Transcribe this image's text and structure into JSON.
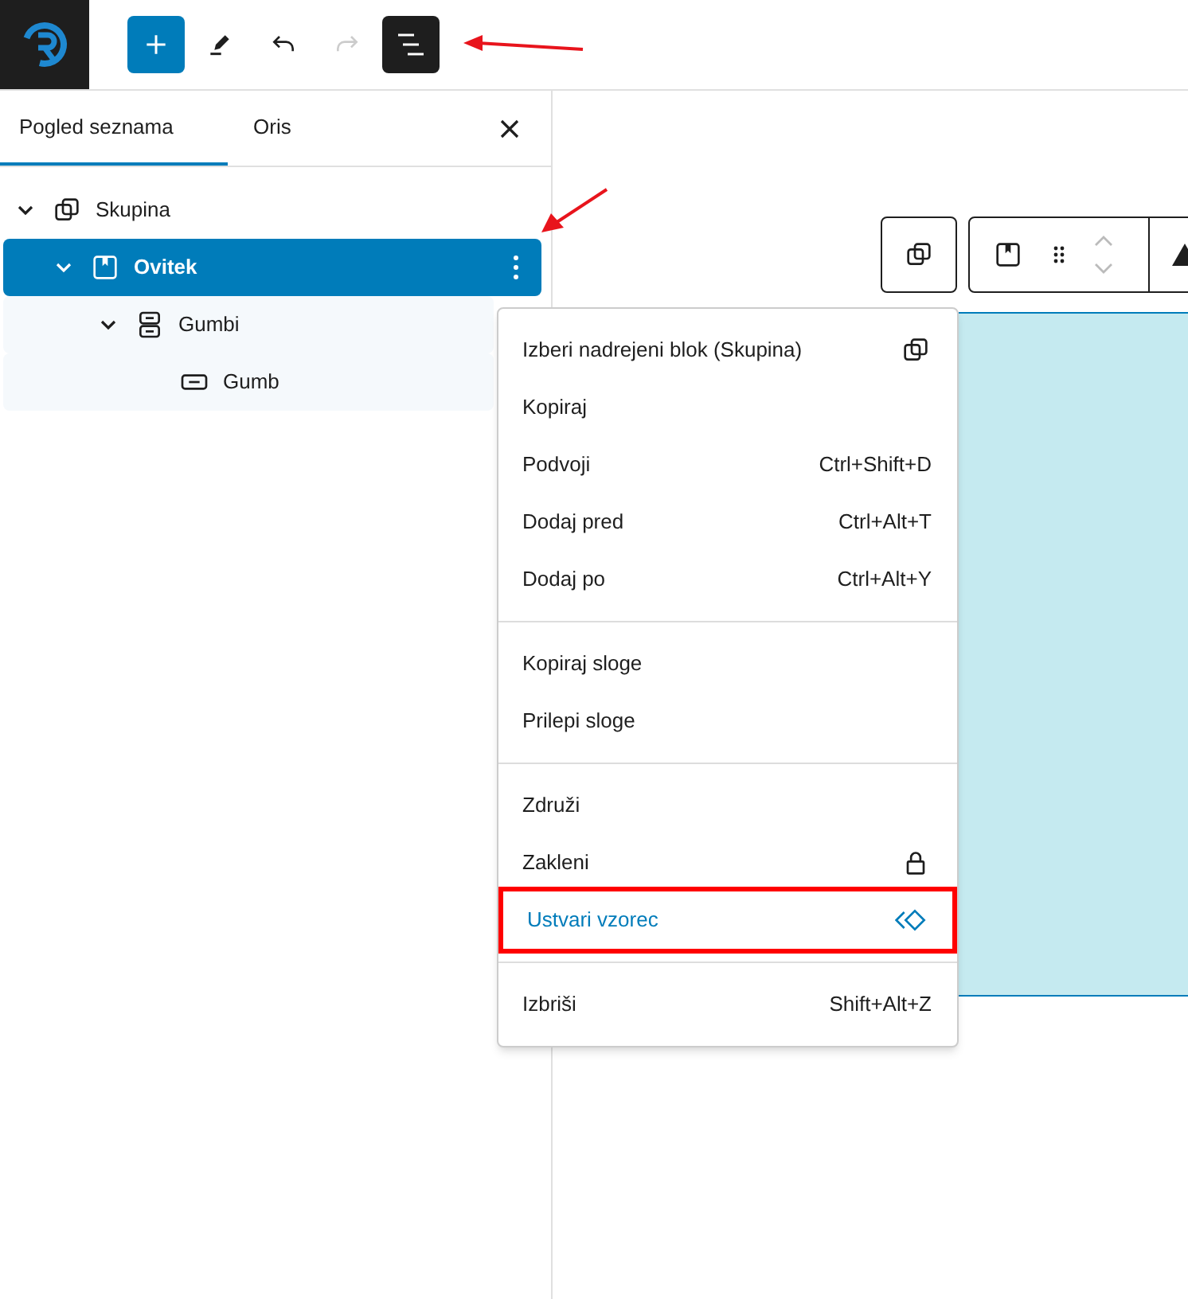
{
  "toolbar": [
    {
      "kind": "add"
    },
    {
      "kind": "edit"
    },
    {
      "kind": "undo"
    },
    {
      "kind": "redo",
      "disabled": true
    },
    {
      "kind": "list-view",
      "selected": true
    }
  ],
  "panel": {
    "tabs": [
      {
        "label": "Pogled seznama",
        "selected": true
      },
      {
        "label": "Oris",
        "selected": false
      }
    ],
    "tree": [
      {
        "label": "Skupina",
        "kind": "group",
        "expanded": true,
        "selected": false,
        "children": [
          {
            "label": "Ovitek",
            "kind": "cover",
            "expanded": true,
            "selected": true,
            "children": [
              {
                "label": "Gumbi",
                "kind": "buttons",
                "expanded": true,
                "selected": false,
                "children": [
                  {
                    "label": "Gumb",
                    "kind": "button",
                    "selected": false
                  }
                ]
              }
            ]
          }
        ]
      }
    ]
  },
  "menu": {
    "groups": [
      [
        {
          "label": "Izberi nadrejeni blok (Skupina)",
          "kind": "group",
          "highlighted": false
        },
        {
          "label": "Kopiraj",
          "highlighted": false
        },
        {
          "label": "Podvoji",
          "shortcut": "Ctrl+Shift+D",
          "highlighted": false
        },
        {
          "label": "Dodaj pred",
          "shortcut": "Ctrl+Alt+T",
          "highlighted": false
        },
        {
          "label": "Dodaj po",
          "shortcut": "Ctrl+Alt+Y",
          "highlighted": false
        }
      ],
      [
        {
          "label": "Kopiraj sloge",
          "highlighted": false
        },
        {
          "label": "Prilepi sloge",
          "highlighted": false
        }
      ],
      [
        {
          "label": "Združi",
          "highlighted": false
        },
        {
          "label": "Zakleni",
          "kind": "lock",
          "highlighted": false
        },
        {
          "label": "Ustvari vzorec",
          "kind": "pattern",
          "highlighted": true
        }
      ],
      [
        {
          "label": "Izbriši",
          "shortcut": "Shift+Alt+Z",
          "highlighted": false
        }
      ]
    ]
  }
}
